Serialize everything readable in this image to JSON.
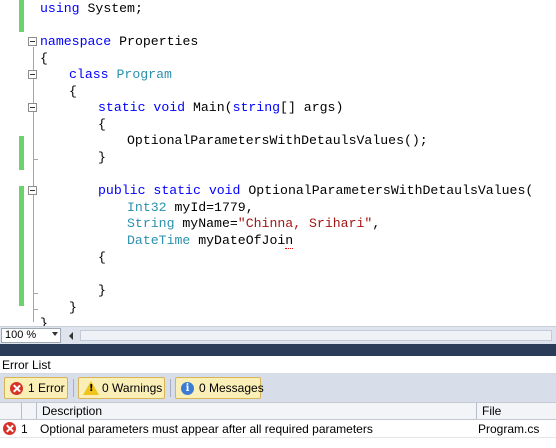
{
  "editor": {
    "lines": {
      "l0": {
        "kw": "using",
        "rest": " System;"
      },
      "l2": {
        "kw": "namespace",
        "rest": " Properties"
      },
      "l3": {
        "text": "{"
      },
      "l4": {
        "kw": "class",
        "cls": "Program"
      },
      "l5": {
        "text": "{"
      },
      "l6": {
        "kw1": "static",
        "kw2": "void",
        "name": "Main(",
        "kw3": "string",
        "rest": "[] args)"
      },
      "l7": {
        "text": "{"
      },
      "l8": {
        "text": "OptionalParametersWithDetaulsValues();"
      },
      "l9": {
        "text": "}"
      },
      "l11": {
        "kw1": "public",
        "kw2": "static",
        "kw3": "void",
        "rest": "OptionalParametersWithDetaulsValues("
      },
      "l12": {
        "type": "Int32",
        "rest": " myId=1779,"
      },
      "l13": {
        "type": "String",
        "mid": " myName=",
        "str": "\"Chinna, Srihari\"",
        "rest": ","
      },
      "l14": {
        "type": "DateTime",
        "rest": " myDateOfJoi",
        "squig": "n"
      },
      "l15": {
        "text": "{"
      },
      "l17": {
        "text": "}"
      },
      "l18": {
        "text": "}"
      },
      "l19": {
        "text": "}"
      }
    }
  },
  "zoom": {
    "value": "100 %"
  },
  "error_list": {
    "title": "Error List",
    "filters": {
      "errors": "1 Error",
      "warnings": "0 Warnings",
      "messages": "0 Messages"
    },
    "columns": {
      "description": "Description",
      "file": "File"
    },
    "rows": [
      {
        "index": "1",
        "description": "Optional parameters must appear after all required parameters",
        "file": "Program.cs"
      }
    ]
  },
  "colors": {
    "keyword": "#0000ff",
    "type": "#2b91af",
    "string": "#a31515",
    "change_bar": "#6cd26c",
    "splitter": "#2b3c59"
  }
}
